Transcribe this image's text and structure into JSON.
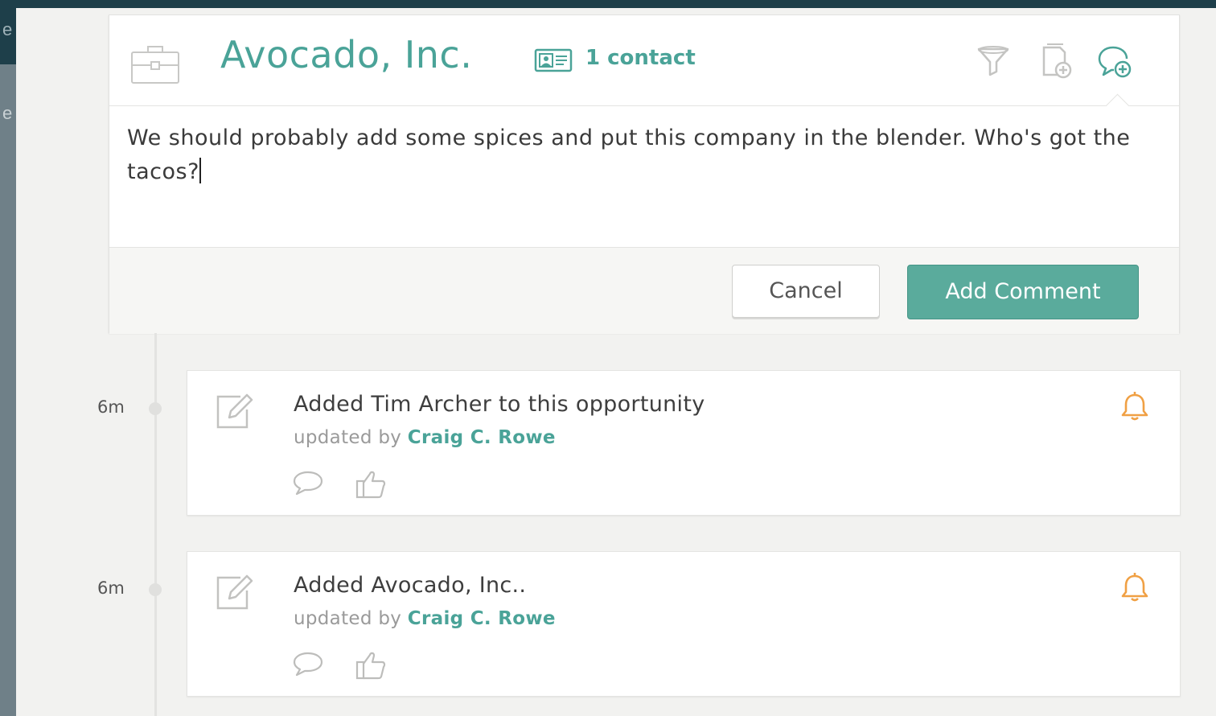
{
  "background": {
    "left_fragments": [
      "e",
      "e"
    ]
  },
  "composer": {
    "company_name": "Avocado, Inc.",
    "contact_count": "1 contact",
    "comment_text": "We should probably add some spices and put this company in the blender. Who's got the tacos?",
    "cancel_label": "Cancel",
    "submit_label": "Add Comment",
    "header_actions": [
      "funnel-icon",
      "add-document-icon",
      "add-comment-icon"
    ]
  },
  "colors": {
    "accent": "#4aa398",
    "button": "#5aab9c",
    "bell": "#f0a044",
    "topbar": "#1e3f4a"
  },
  "timeline": [
    {
      "time": "6m",
      "title": "Added Tim Archer to this opportunity",
      "updated_by_label": "updated by",
      "author": "Craig C. Rowe"
    },
    {
      "time": "6m",
      "title": "Added Avocado, Inc..",
      "updated_by_label": "updated by",
      "author": "Craig C. Rowe"
    }
  ]
}
